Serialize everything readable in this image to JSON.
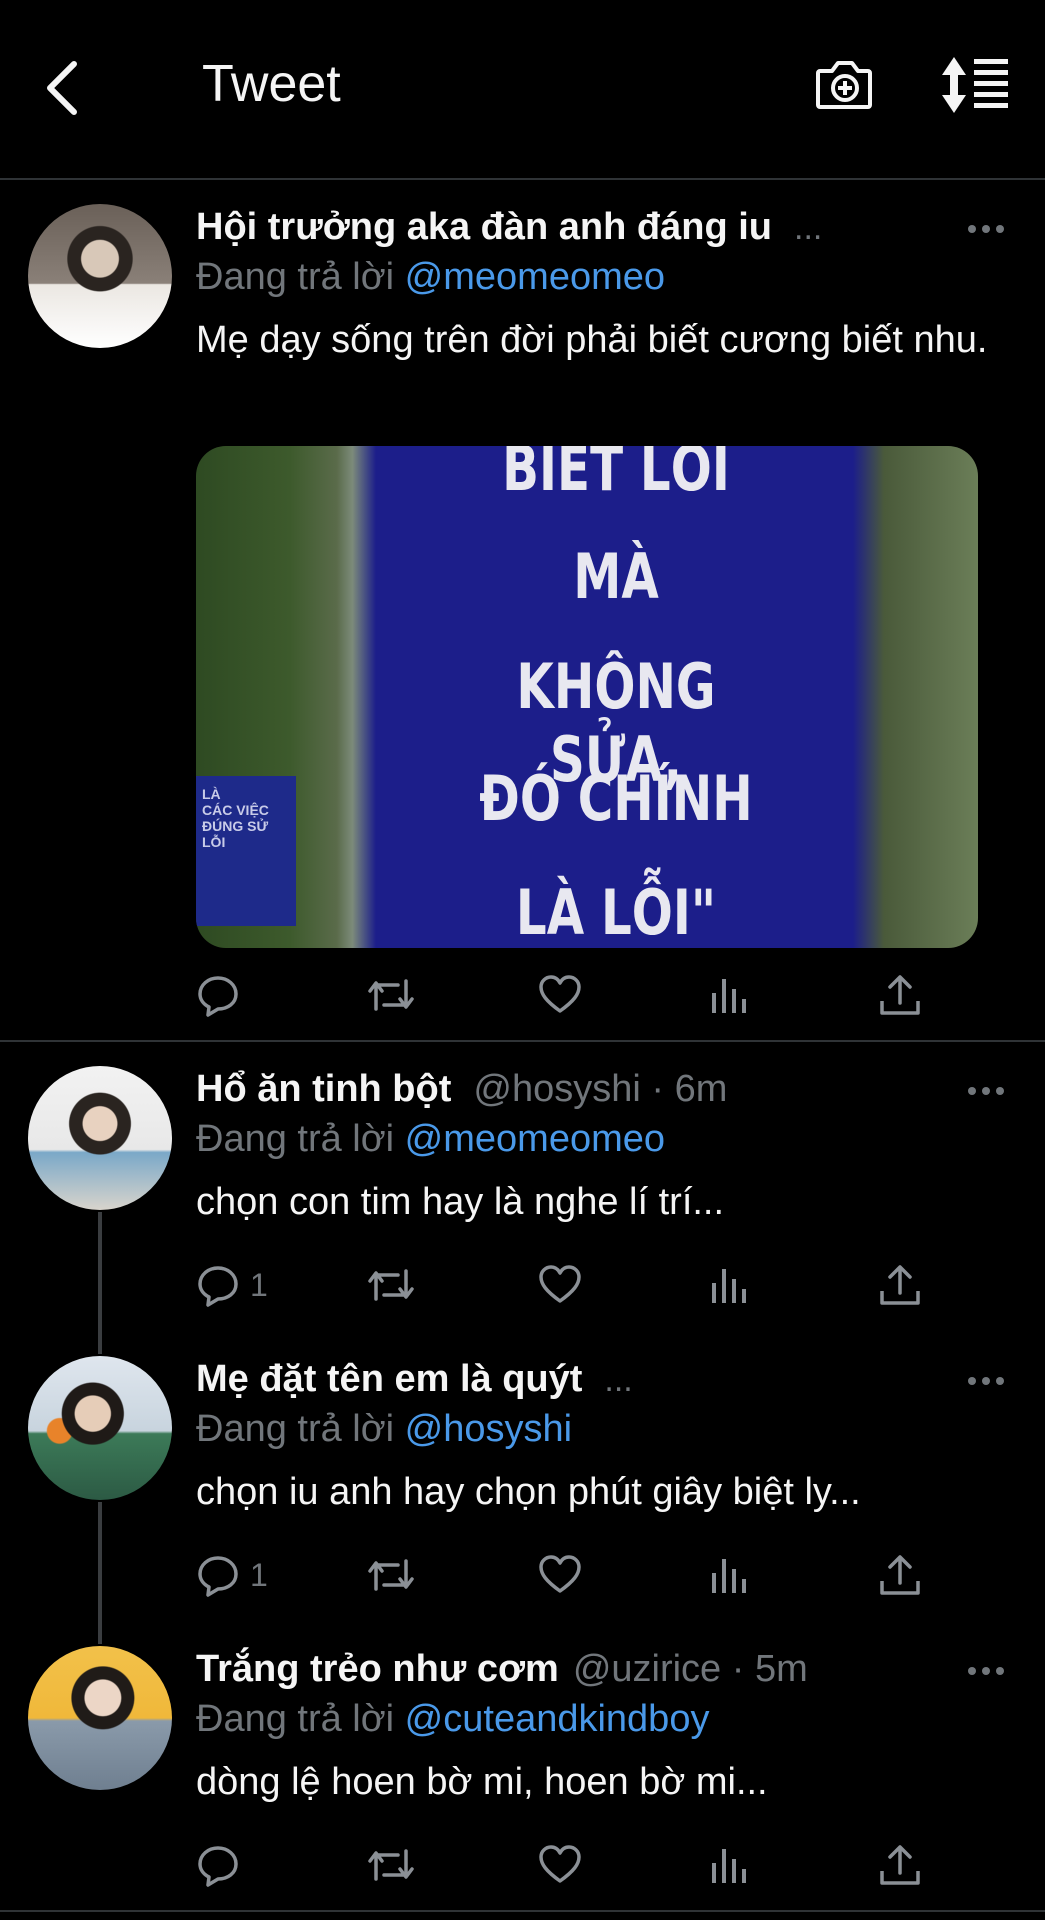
{
  "header": {
    "title": "Tweet",
    "back_icon": "chevron-left-icon",
    "camera_icon": "camera-plus-icon",
    "sort_icon": "sort-list-icon"
  },
  "main_tweet": {
    "name": "Hội trưởng aka đàn anh đáng iu",
    "ellipsis": "...",
    "reply_prefix": "Đang trả lời",
    "reply_to": "@meomeomeo",
    "text": "Mẹ dạy sống trên đời phải biết cương biết nhu.",
    "media_text": [
      "BIẾT LỖI",
      "MÀ",
      "KHÔNG SỬA,",
      "ĐÓ CHÍNH",
      "LÀ LỖI\""
    ],
    "small_sign_text": "LÀ\nCÁC VIỆC\nĐÚNG SỬ LỖI"
  },
  "replies": [
    {
      "name": "Hổ ăn tinh bột",
      "handle": "@hosyshi · 6m",
      "reply_prefix": "Đang trả lời",
      "reply_to": "@meomeomeo",
      "text": "chọn con tim hay là nghe lí trí...",
      "reply_count": "1"
    },
    {
      "name": "Mẹ đặt tên em là quýt",
      "handle": "...",
      "reply_prefix": "Đang trả lời",
      "reply_to": "@hosyshi",
      "text": "chọn iu anh hay chọn phút giây biệt ly...",
      "reply_count": "1"
    },
    {
      "name": "Trắng trẻo như cơm",
      "handle": "@uzirice · 5m",
      "reply_prefix": "Đang trả lời",
      "reply_to": "@cuteandkindboy",
      "text": "dòng lệ hoen bờ mi, hoen bờ mi...",
      "reply_count": ""
    }
  ],
  "colors": {
    "background": "#000000",
    "mention": "#4a99e9",
    "secondary_text": "#71767b",
    "divider": "#2f3336"
  }
}
